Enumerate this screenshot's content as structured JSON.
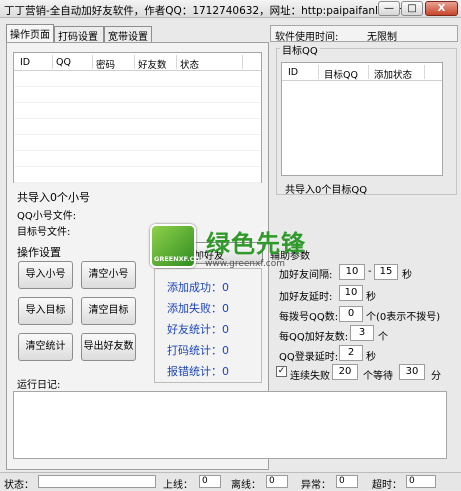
{
  "window": {
    "title": "丁丁营销-全自动加好友软件，作者QQ：1712740632，网址：http:paipaifanl.com",
    "minimize": "—",
    "maximize": "□",
    "close": "X"
  },
  "tabs": [
    "操作页面",
    "打码设置",
    "宽带设置"
  ],
  "usage": {
    "label": "软件使用时间:",
    "value": "无限制"
  },
  "qq_table": {
    "columns": [
      "ID",
      "QQ",
      "密码",
      "好友数",
      "状态"
    ]
  },
  "target_group": {
    "title": "目标QQ",
    "columns": [
      "ID",
      "目标QQ",
      "添加状态"
    ],
    "summary": "共导入0个目标QQ"
  },
  "import_info": {
    "count": "共导入0个小号",
    "qq_file": "QQ小号文件:",
    "target_file": "目标号文件:"
  },
  "ops": {
    "title": "操作设置",
    "buttons": [
      "导入小号",
      "清空小号",
      "导入目标",
      "清空目标",
      "清空统计",
      "导出好友数"
    ]
  },
  "stats": {
    "title": "开始加好友",
    "items": [
      "添加成功：0",
      "添加失败：0",
      "好友统计：0",
      "打码统计：0",
      "报错统计：0"
    ]
  },
  "aux": {
    "title": "辅助参数",
    "interval_label": "加好友间隔:",
    "interval_min": "10",
    "interval_dash": "-",
    "interval_max": "15",
    "interval_unit": "秒",
    "delay_label": "加好友延时:",
    "delay_value": "10",
    "delay_unit": "秒",
    "dial_label": "每拨号QQ数:",
    "dial_value": "0",
    "dial_note": "个(0表示不拨号)",
    "per_qq_label": "每QQ加好友数:",
    "per_qq_value": "3",
    "per_qq_unit": "个",
    "login_label": "QQ登录延时:",
    "login_value": "2",
    "login_unit": "秒",
    "fail_label": "连续失败",
    "fail_value": "20",
    "fail_mid": "个等待",
    "fail_wait": "30",
    "fail_unit": "分"
  },
  "log": {
    "label": "运行日记:"
  },
  "statusbar": {
    "status_label": "状态：",
    "online_label": "上线：",
    "online_value": "0",
    "offline_label": "离线：",
    "offline_value": "0",
    "abnormal_label": "异常：",
    "abnormal_value": "0",
    "timeout_label": "超时：",
    "timeout_value": "0"
  },
  "watermark": {
    "logo_text": "GREENXF.COM",
    "text": "绿色先锋",
    "url": "www.greenxf.com"
  }
}
